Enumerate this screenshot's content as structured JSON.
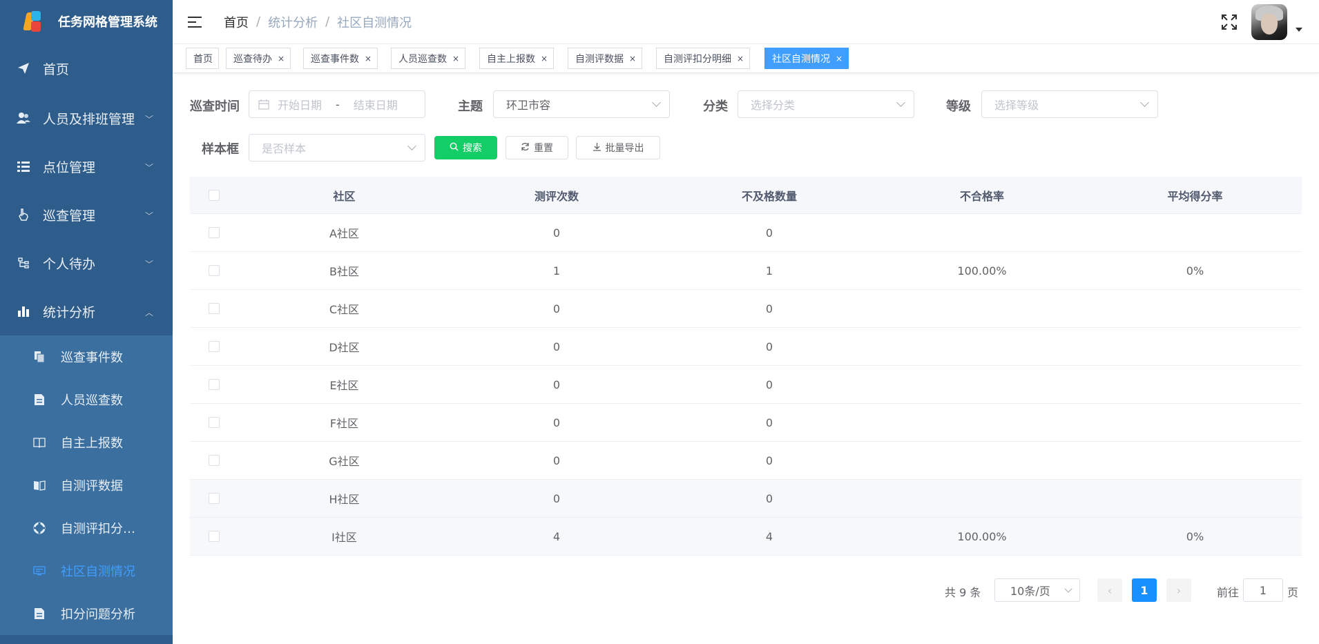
{
  "app": {
    "title": "任务网格管理系统"
  },
  "sidebar": {
    "menu": [
      {
        "label": "首页",
        "icon": "send-icon"
      },
      {
        "label": "人员及排班管理",
        "icon": "users-icon"
      },
      {
        "label": "点位管理",
        "icon": "list-icon"
      },
      {
        "label": "巡查管理",
        "icon": "hand-icon"
      },
      {
        "label": "个人待办",
        "icon": "tree-icon"
      },
      {
        "label": "统计分析",
        "icon": "bar-chart-icon"
      }
    ],
    "submenu": [
      {
        "label": "巡查事件数",
        "icon": "copy-icon"
      },
      {
        "label": "人员巡查数",
        "icon": "document-icon"
      },
      {
        "label": "自主上报数",
        "icon": "book-icon"
      },
      {
        "label": "自测评数据",
        "icon": "reading-icon"
      },
      {
        "label": "自测评扣分…",
        "icon": "lifebuoy-icon"
      },
      {
        "label": "社区自测情况",
        "icon": "monitor-icon"
      },
      {
        "label": "扣分问题分析",
        "icon": "document-icon"
      }
    ]
  },
  "header": {
    "breadcrumb": {
      "home": "首页",
      "level1": "统计分析",
      "level2": "社区自测情况",
      "sep": "/"
    }
  },
  "tags": [
    {
      "label": "首页",
      "closable": false
    },
    {
      "label": "巡查待办",
      "closable": true
    },
    {
      "label": "巡查事件数",
      "closable": true
    },
    {
      "label": "人员巡查数",
      "closable": true
    },
    {
      "label": "自主上报数",
      "closable": true
    },
    {
      "label": "自测评数据",
      "closable": true
    },
    {
      "label": "自测评扣分明细",
      "closable": true
    },
    {
      "label": "社区自测情况",
      "closable": true,
      "active": true
    }
  ],
  "filters": {
    "time": {
      "label": "巡查时间",
      "start_placeholder": "开始日期",
      "range_sep": "-",
      "end_placeholder": "结束日期"
    },
    "topic": {
      "label": "主题",
      "value": "环卫市容"
    },
    "category": {
      "label": "分类",
      "placeholder": "选择分类"
    },
    "level": {
      "label": "等级",
      "placeholder": "选择等级"
    },
    "sample": {
      "label": "样本框",
      "placeholder": "是否样本"
    },
    "buttons": {
      "search": "搜索",
      "reset": "重置",
      "export": "批量导出"
    }
  },
  "table": {
    "columns": [
      "社区",
      "测评次数",
      "不及格数量",
      "不合格率",
      "平均得分率"
    ],
    "rows": [
      {
        "community": "A社区",
        "count": "0",
        "fail": "0",
        "fail_rate": "",
        "avg_rate": ""
      },
      {
        "community": "B社区",
        "count": "1",
        "fail": "1",
        "fail_rate": "100.00%",
        "avg_rate": "0%"
      },
      {
        "community": "C社区",
        "count": "0",
        "fail": "0",
        "fail_rate": "",
        "avg_rate": ""
      },
      {
        "community": "D社区",
        "count": "0",
        "fail": "0",
        "fail_rate": "",
        "avg_rate": ""
      },
      {
        "community": "E社区",
        "count": "0",
        "fail": "0",
        "fail_rate": "",
        "avg_rate": ""
      },
      {
        "community": "F社区",
        "count": "0",
        "fail": "0",
        "fail_rate": "",
        "avg_rate": ""
      },
      {
        "community": "G社区",
        "count": "0",
        "fail": "0",
        "fail_rate": "",
        "avg_rate": ""
      },
      {
        "community": "H社区",
        "count": "0",
        "fail": "0",
        "fail_rate": "",
        "avg_rate": ""
      },
      {
        "community": "I社区",
        "count": "4",
        "fail": "4",
        "fail_rate": "100.00%",
        "avg_rate": "0%"
      }
    ]
  },
  "pagination": {
    "total_text": "共 9 条",
    "page_size": "10条/页",
    "current_page": "1",
    "goto_label": "前往",
    "goto_value": "1",
    "goto_unit": "页"
  },
  "colors": {
    "sidebar": "#2f5d8b",
    "submenu": "#3a6f9f",
    "active_tag": "#409eff",
    "search_button": "#13ce66",
    "page_active": "#1890ff"
  }
}
